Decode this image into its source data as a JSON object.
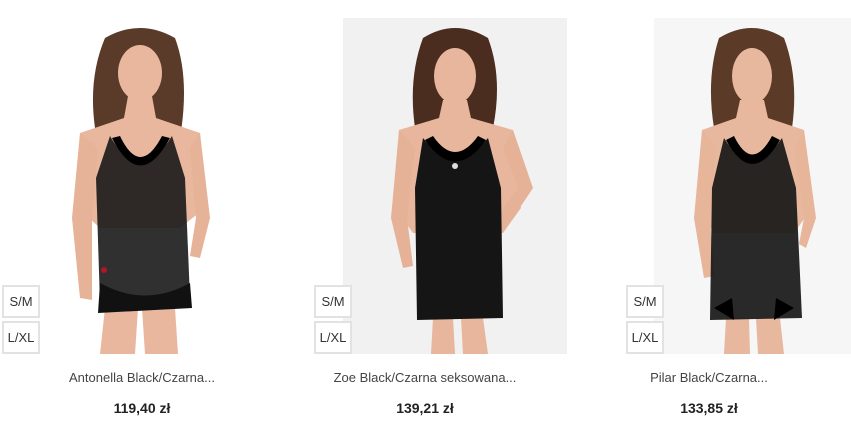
{
  "products": [
    {
      "name": "Antonella Black/Czarna...",
      "price": "119,40 zł",
      "sizes": [
        "S/M",
        "L/XL"
      ]
    },
    {
      "name": "Zoe Black/Czarna seksowana...",
      "price": "139,21 zł",
      "sizes": [
        "S/M",
        "L/XL"
      ]
    },
    {
      "name": "Pilar Black/Czarna...",
      "price": "133,85 zł",
      "sizes": [
        "S/M",
        "L/XL"
      ]
    }
  ]
}
